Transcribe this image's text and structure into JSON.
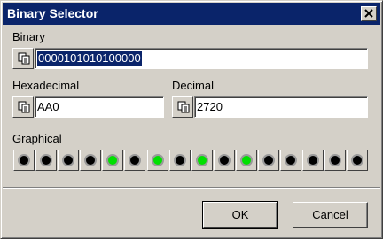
{
  "window": {
    "title": "Binary Selector"
  },
  "binary": {
    "label": "Binary",
    "value": "0000101010100000"
  },
  "hex": {
    "label": "Hexadecimal",
    "value": "AA0"
  },
  "decimal": {
    "label": "Decimal",
    "value": "2720"
  },
  "graphical": {
    "label": "Graphical",
    "bits": [
      0,
      0,
      0,
      0,
      1,
      0,
      1,
      0,
      1,
      0,
      1,
      0,
      0,
      0,
      0,
      0
    ],
    "colors": {
      "on": "#00e000",
      "off": "#000000"
    }
  },
  "buttons": {
    "ok": "OK",
    "cancel": "Cancel"
  },
  "icons": {
    "copy": "copy-icon",
    "close": "close-icon"
  }
}
